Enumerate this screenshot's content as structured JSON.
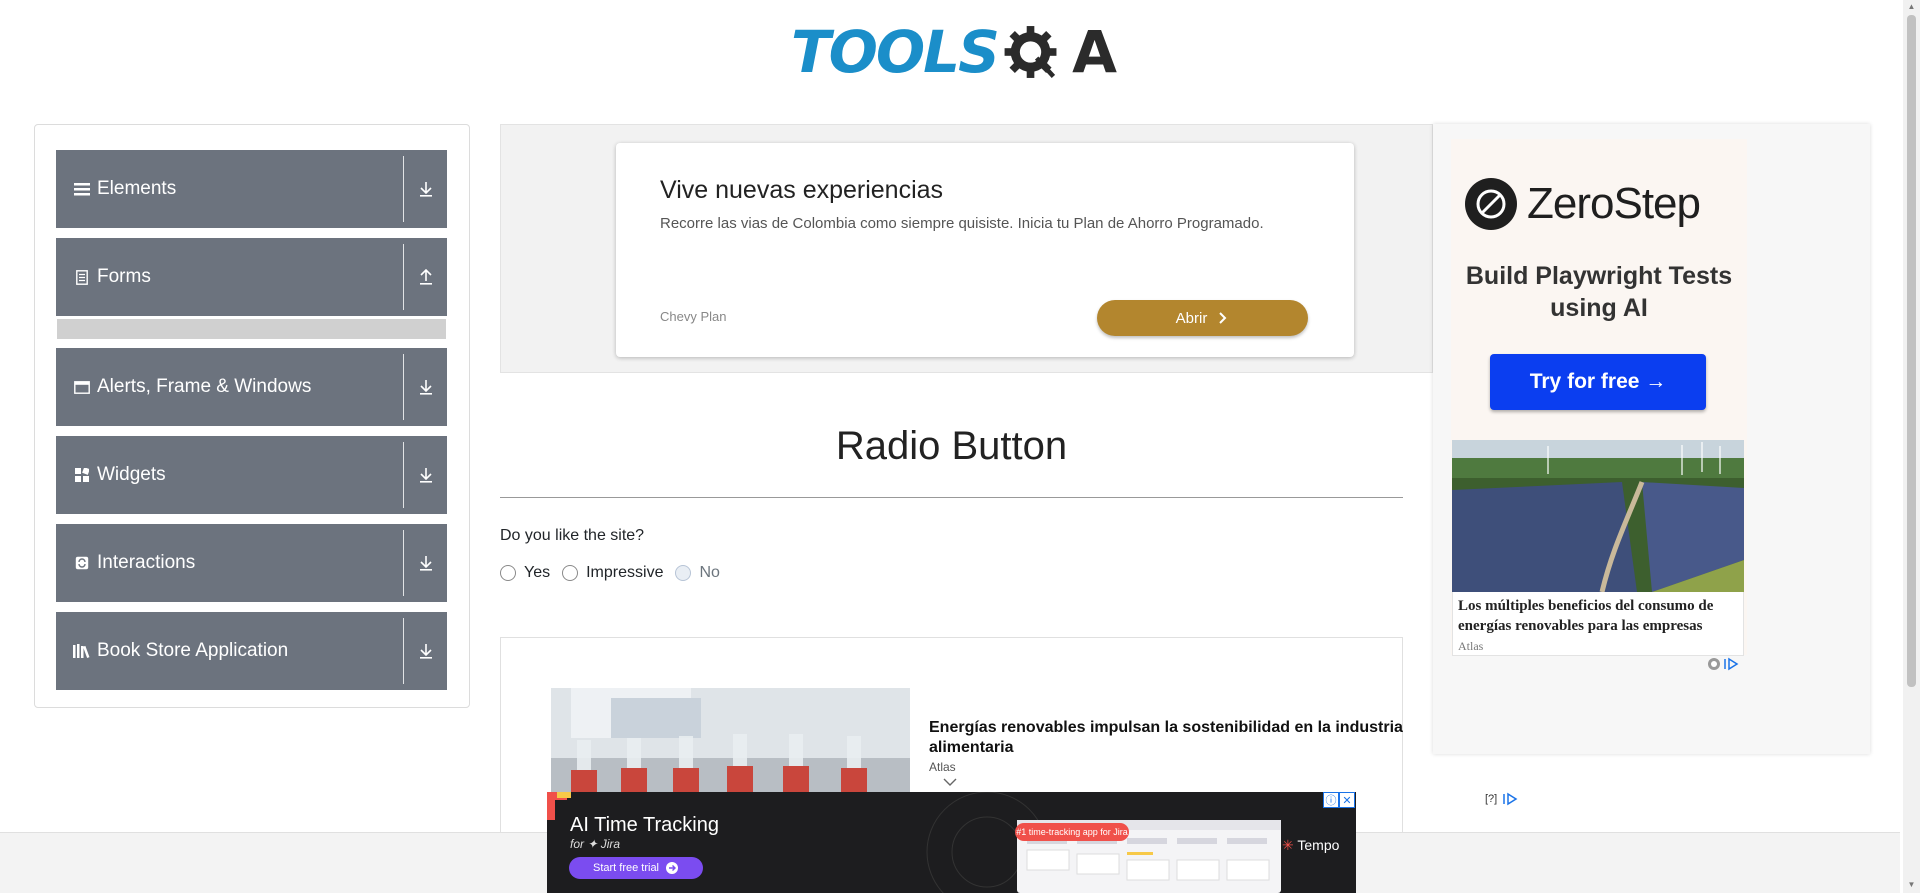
{
  "header": {
    "logo_text": "TOOLS",
    "logo_end": "A"
  },
  "sidebar": {
    "groups": [
      {
        "label": "Elements",
        "icon": "hamburger-icon",
        "arrow": "download-arrow-icon"
      },
      {
        "label": "Forms",
        "icon": "document-icon",
        "arrow": "upload-arrow-icon"
      },
      {
        "label": "Alerts, Frame & Windows",
        "icon": "window-icon",
        "arrow": "download-arrow-icon"
      },
      {
        "label": "Widgets",
        "icon": "widgets-icon",
        "arrow": "download-arrow-icon"
      },
      {
        "label": "Interactions",
        "icon": "interactions-icon",
        "arrow": "download-arrow-icon"
      },
      {
        "label": "Book Store Application",
        "icon": "books-icon",
        "arrow": "download-arrow-icon"
      }
    ]
  },
  "ad_top": {
    "title": "Vive nuevas experiencias",
    "description": "Recorre las vias de Colombia como siempre quisiste. Inicia tu Plan de Ahorro Programado.",
    "brand": "Chevy Plan",
    "button": "Abrir"
  },
  "main": {
    "title": "Radio Button",
    "question": "Do you like the site?",
    "options": [
      {
        "label": "Yes",
        "disabled": false
      },
      {
        "label": "Impressive",
        "disabled": false
      },
      {
        "label": "No",
        "disabled": true
      }
    ]
  },
  "ad_bottom": {
    "headline": "Energías renovables impulsan la sostenibilidad en la industria alimentaria",
    "source": "Atlas"
  },
  "ad_right": {
    "brand": "ZeroStep",
    "headline": "Build Playwright Tests using AI",
    "button": "Try for free →",
    "caption": "Los múltiples beneficios del consumo de energías renovables para las empresas",
    "caption_source": "Atlas",
    "qmark": "[?]"
  },
  "tempo_ad": {
    "title": "AI Time Tracking",
    "subtitle": "for ✦ Jira",
    "button": "Start free trial",
    "pill": "#1 time-tracking app for Jira",
    "brand": "Tempo"
  },
  "colors": {
    "logo_blue": "#1b8ec9",
    "sidebar_group": "#6c737e",
    "chevy_gold": "#b3862e",
    "zerostep_blue": "#0b3ef0",
    "tempo_purple": "#7b4cf0"
  }
}
